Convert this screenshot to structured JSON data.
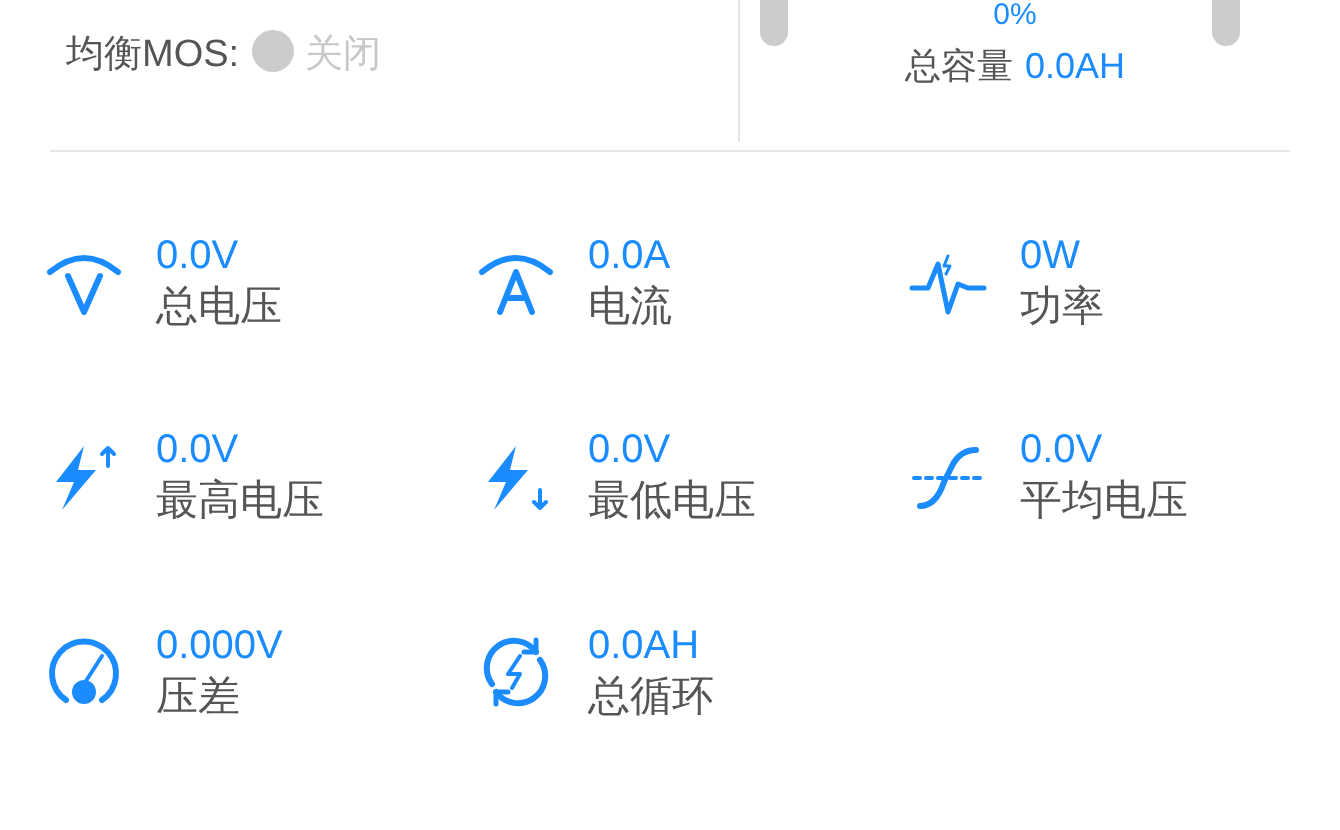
{
  "balance": {
    "label": "均衡MOS:",
    "on": false,
    "status": "关闭"
  },
  "capacity": {
    "percent": "0%",
    "label": "总容量",
    "value": "0.0AH"
  },
  "metrics": [
    {
      "kind": "voltage",
      "value": "0.0V",
      "label": "总电压"
    },
    {
      "kind": "current",
      "value": "0.0A",
      "label": "电流"
    },
    {
      "kind": "power",
      "value": "0W",
      "label": "功率"
    },
    {
      "kind": "max",
      "value": "0.0V",
      "label": "最高电压"
    },
    {
      "kind": "min",
      "value": "0.0V",
      "label": "最低电压"
    },
    {
      "kind": "avg",
      "value": "0.0V",
      "label": "平均电压"
    },
    {
      "kind": "diff",
      "value": "0.000V",
      "label": "压差"
    },
    {
      "kind": "cycle",
      "value": "0.0AH",
      "label": "总循环"
    }
  ]
}
